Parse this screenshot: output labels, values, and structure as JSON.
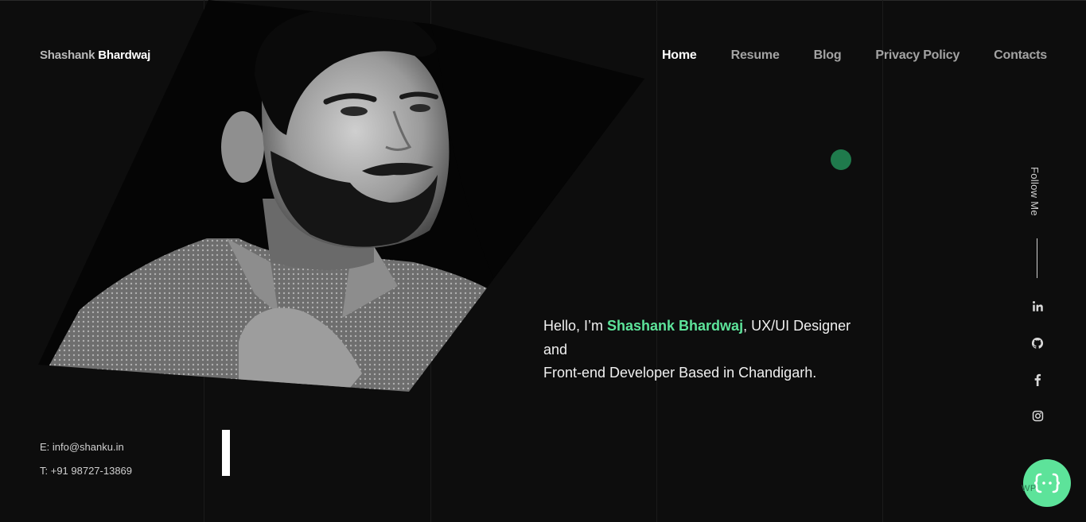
{
  "header": {
    "logo_first": "Shashank",
    "logo_last": "Bhardwaj",
    "nav": [
      {
        "label": "Home",
        "active": true
      },
      {
        "label": "Resume"
      },
      {
        "label": "Blog"
      },
      {
        "label": "Privacy Policy"
      },
      {
        "label": "Contacts"
      }
    ]
  },
  "hero": {
    "greeting": "Hello, I’m ",
    "name": "Shashank Bhardwaj",
    "role": ", UX/UI Designer",
    "line2": "and",
    "line3": "Front-end Developer Based in Chandigarh."
  },
  "sidebar": {
    "follow_label": "Follow Me",
    "social": [
      "linkedin-icon",
      "github-icon",
      "facebook-icon",
      "instagram-icon"
    ]
  },
  "contact": {
    "email": "E: info@shanku.in",
    "phone": "T: +91 98727-13869"
  },
  "fab": {
    "icon": "code-braces-icon",
    "label": "WP"
  },
  "colors": {
    "background": "#0d0d0d",
    "accent": "#5de39a",
    "accent_dark": "#1f7a4c"
  }
}
